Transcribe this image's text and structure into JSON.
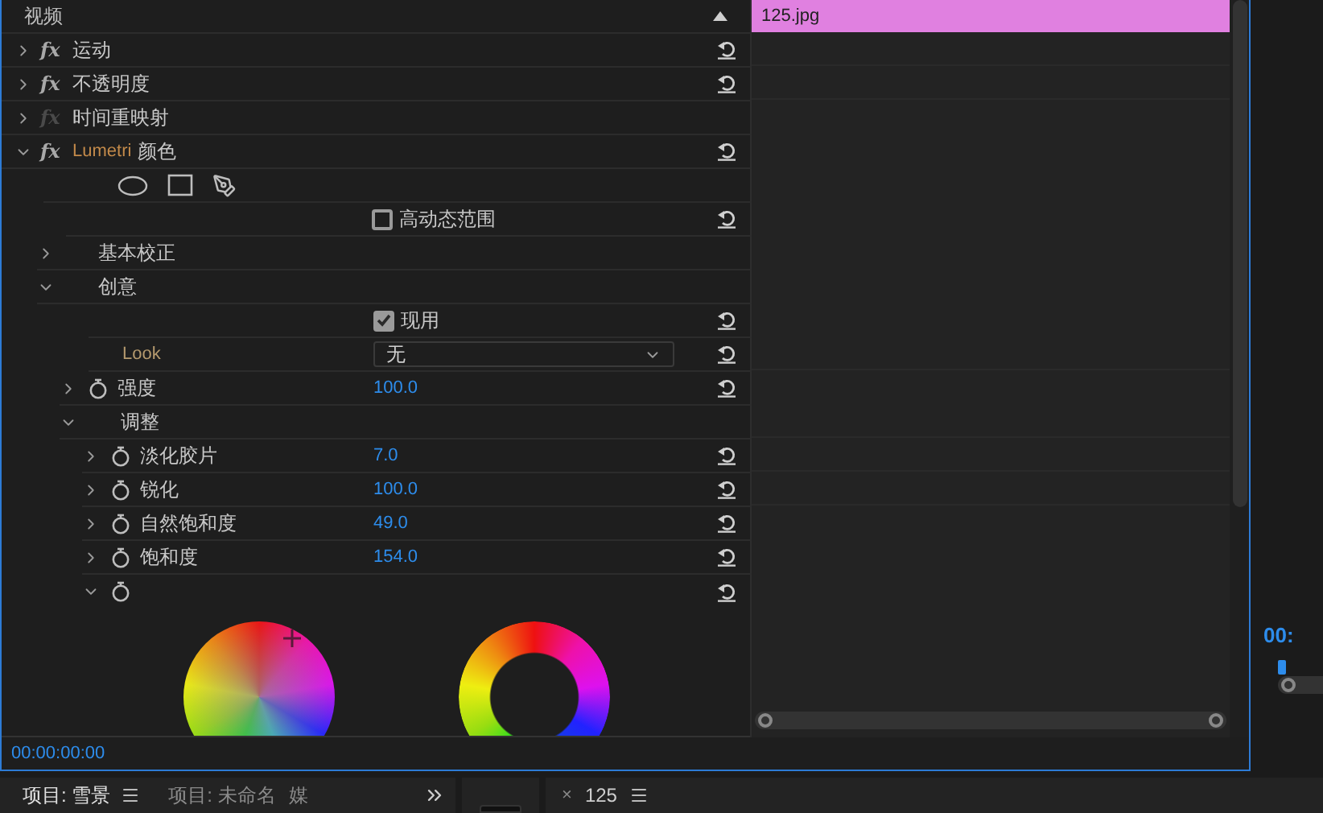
{
  "panel_title": "视频",
  "effects": [
    {
      "badge": "fx",
      "name": "运动",
      "fx_enabled": true,
      "expanded": false,
      "resettable": true
    },
    {
      "badge": "fx",
      "name": "不透明度",
      "fx_enabled": true,
      "expanded": false,
      "resettable": true
    },
    {
      "badge": "fx",
      "name": "时间重映射",
      "fx_enabled": false,
      "expanded": false,
      "resettable": false
    },
    {
      "badge": "fx",
      "brand": "Lumetri",
      "name": "颜色",
      "fx_enabled": true,
      "expanded": true,
      "resettable": true
    }
  ],
  "hdr": {
    "label": "高动态范围",
    "checked": false
  },
  "sections": [
    {
      "name": "基本校正",
      "expanded": false
    },
    {
      "name": "创意",
      "expanded": true
    }
  ],
  "creative": {
    "enable": {
      "label": "现用",
      "checked": true
    },
    "look": {
      "label": "Look",
      "value": "无"
    },
    "intensity": {
      "name": "强度",
      "value": "100.0",
      "expanded": false
    },
    "adjust": {
      "name": "调整",
      "expanded": true
    },
    "params": [
      {
        "name": "淡化胶片",
        "value": "7.0",
        "expanded": false
      },
      {
        "name": "锐化",
        "value": "100.0",
        "expanded": false
      },
      {
        "name": "自然饱和度",
        "value": "49.0",
        "expanded": false
      },
      {
        "name": "饱和度",
        "value": "154.0",
        "expanded": false
      }
    ],
    "wheels": {
      "expanded": true
    }
  },
  "timecode": "00:00:00:00",
  "clip": {
    "name": "125.jpg",
    "color": "#e080e0"
  },
  "monitor_timecode": "00:",
  "bottom_tabs": [
    {
      "label": "项目: 雪景",
      "selected": true,
      "menu": true
    },
    {
      "label": "项目: 未命名",
      "selected": false,
      "menu": false
    },
    {
      "label": "媒",
      "selected": false,
      "menu": false
    }
  ],
  "sequence_tab": {
    "close": "×",
    "label": "125"
  }
}
